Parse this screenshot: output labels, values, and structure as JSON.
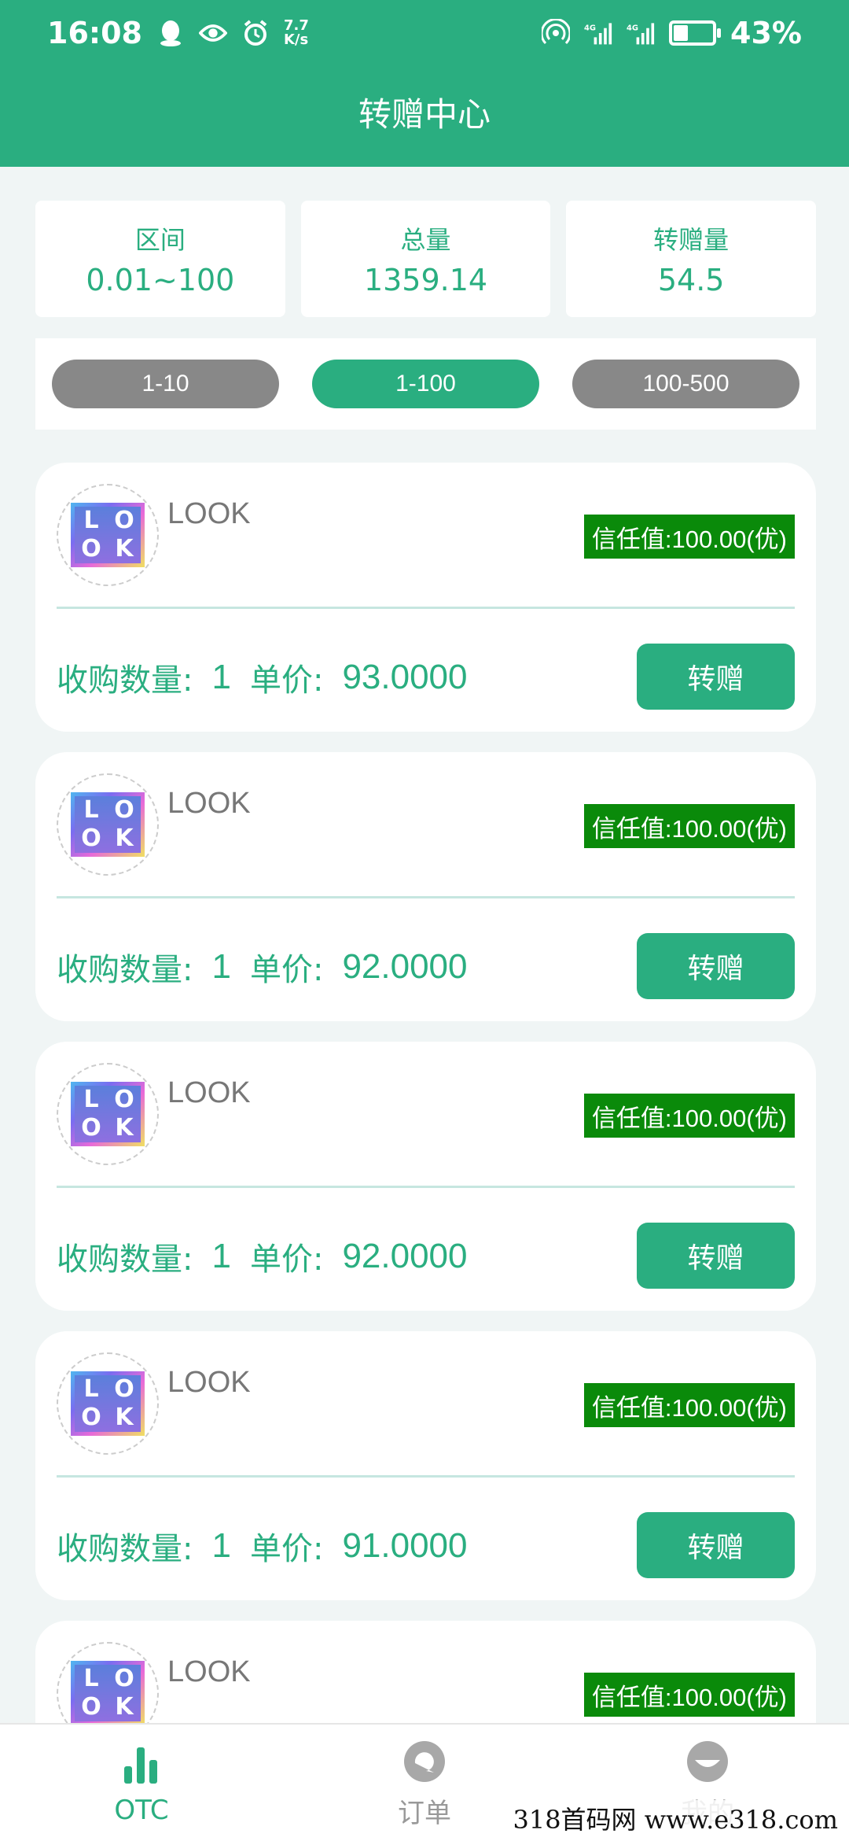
{
  "status_bar": {
    "time": "16:08",
    "net_speed_value": "7.7",
    "net_speed_unit": "K/s",
    "battery": "43%",
    "battery_level": 0.43,
    "icons": [
      "qq-icon",
      "eye-icon",
      "alarm-icon",
      "hotspot-icon",
      "signal-4g-icon",
      "signal-4g-icon",
      "battery-icon"
    ]
  },
  "header": {
    "title": "转赠中心"
  },
  "stats": [
    {
      "label": "区间",
      "value": "0.01~100"
    },
    {
      "label": "总量",
      "value": "1359.14"
    },
    {
      "label": "转赠量",
      "value": "54.5"
    }
  ],
  "filters": [
    {
      "label": "1-10",
      "active": false
    },
    {
      "label": "1-100",
      "active": true
    },
    {
      "label": "100-500",
      "active": false
    }
  ],
  "listings": [
    {
      "name": "LOOK",
      "trust": "信任值:100.00(优)",
      "qty_label": "收购数量:",
      "qty": "1",
      "price_label": "单价:",
      "price": "93.0000",
      "button": "转赠"
    },
    {
      "name": "LOOK",
      "trust": "信任值:100.00(优)",
      "qty_label": "收购数量:",
      "qty": "1",
      "price_label": "单价:",
      "price": "92.0000",
      "button": "转赠"
    },
    {
      "name": "LOOK",
      "trust": "信任值:100.00(优)",
      "qty_label": "收购数量:",
      "qty": "1",
      "price_label": "单价:",
      "price": "92.0000",
      "button": "转赠"
    },
    {
      "name": "LOOK",
      "trust": "信任值:100.00(优)",
      "qty_label": "收购数量:",
      "qty": "1",
      "price_label": "单价:",
      "price": "91.0000",
      "button": "转赠"
    },
    {
      "name": "LOOK",
      "trust": "信任值:100.00(优)"
    }
  ],
  "logo_letters": [
    "L",
    "O",
    "O",
    "K"
  ],
  "bottom_nav": [
    {
      "label": "OTC",
      "icon": "bar-chart-icon",
      "active": true
    },
    {
      "label": "订单",
      "icon": "order-icon",
      "active": false
    },
    {
      "label": "我的",
      "icon": "profile-icon",
      "active": false
    }
  ],
  "watermark": "318首码网  www.e318.com",
  "colors": {
    "primary": "#2aae80",
    "trust_badge": "#0a8a0a",
    "inactive_filter": "#888888",
    "background": "#f0f5f5"
  }
}
